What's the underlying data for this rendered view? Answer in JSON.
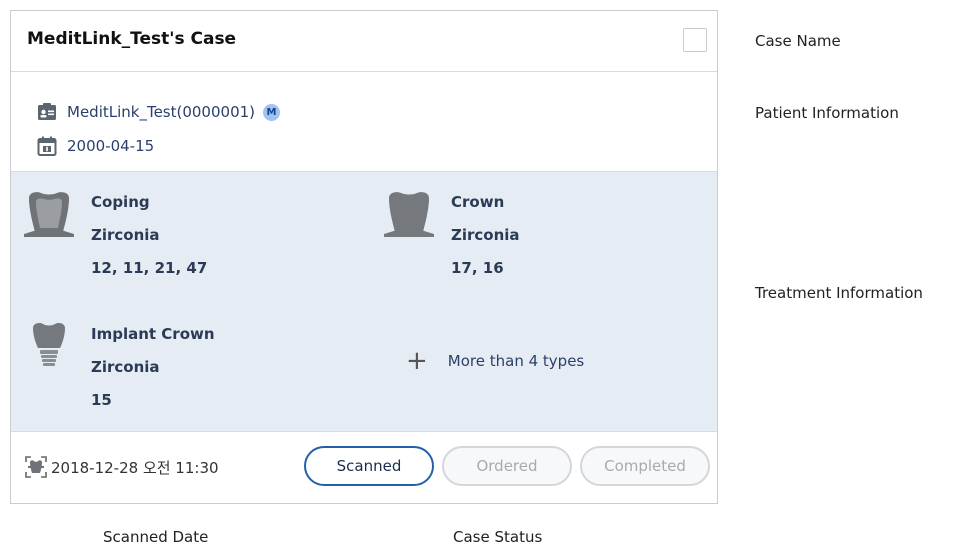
{
  "card": {
    "title": "MeditLink_Test's Case",
    "patient": {
      "name_id": "MeditLink_Test(0000001)",
      "badge": "M",
      "birth_date": "2000-04-15"
    },
    "treatments": [
      {
        "type": "Coping",
        "material": "Zirconia",
        "teeth": "12, 11, 21, 47",
        "icon": "coping-tooth-icon"
      },
      {
        "type": "Crown",
        "material": "Zirconia",
        "teeth": "17, 16",
        "icon": "crown-tooth-icon"
      },
      {
        "type": "Implant Crown",
        "material": "Zirconia",
        "teeth": "15",
        "icon": "implant-crown-icon"
      }
    ],
    "more_label": "More than 4 types",
    "scanned_date": "2018-12-28 오전 11:30",
    "statuses": [
      {
        "label": "Scanned",
        "active": true
      },
      {
        "label": "Ordered",
        "active": false
      },
      {
        "label": "Completed",
        "active": false
      }
    ],
    "colors": {
      "accent": "#2261a8",
      "treatment_bg": "#e6ecf4",
      "badge_bg": "#9fc3f3"
    }
  },
  "annotations": {
    "case_name": "Case Name",
    "patient_information": "Patient Information",
    "treatment_information": "Treatment Information",
    "scanned_date": "Scanned Date",
    "case_status": "Case Status"
  }
}
